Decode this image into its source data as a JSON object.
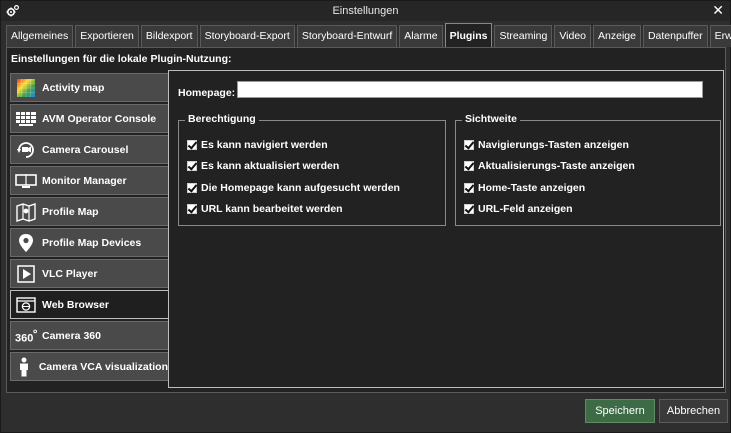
{
  "window": {
    "title": "Einstellungen",
    "close_glyph": "✕"
  },
  "tabs": [
    {
      "label": "Allgemeines",
      "active": false
    },
    {
      "label": "Exportieren",
      "active": false
    },
    {
      "label": "Bildexport",
      "active": false
    },
    {
      "label": "Storyboard-Export",
      "active": false
    },
    {
      "label": "Storyboard-Entwurf",
      "active": false
    },
    {
      "label": "Alarme",
      "active": false
    },
    {
      "label": "Plugins",
      "active": true
    },
    {
      "label": "Streaming",
      "active": false
    },
    {
      "label": "Video",
      "active": false
    },
    {
      "label": "Anzeige",
      "active": false
    },
    {
      "label": "Datenpuffer",
      "active": false
    },
    {
      "label": "Erweitert",
      "active": false
    }
  ],
  "panel": {
    "heading": "Einstellungen für die lokale Plugin-Nutzung:"
  },
  "plugins": [
    {
      "label": "Activity map",
      "icon": "heatmap-icon",
      "active": false
    },
    {
      "label": "AVM Operator Console",
      "icon": "grid-console-icon",
      "active": false
    },
    {
      "label": "Camera Carousel",
      "icon": "camera-carousel-icon",
      "active": false
    },
    {
      "label": "Monitor Manager",
      "icon": "monitor-icon",
      "active": false
    },
    {
      "label": "Profile Map",
      "icon": "map-icon",
      "active": false
    },
    {
      "label": "Profile Map Devices",
      "icon": "map-pin-icon",
      "active": false
    },
    {
      "label": "VLC Player",
      "icon": "vlc-player-icon",
      "active": false
    },
    {
      "label": "Web Browser",
      "icon": "globe-icon",
      "active": true
    },
    {
      "label": "Camera 360",
      "icon": "camera-360-icon",
      "active": false
    },
    {
      "label": "Camera VCA visualization",
      "icon": "person-icon",
      "active": false
    }
  ],
  "content": {
    "homepage_label": "Homepage:",
    "homepage_value": "",
    "permissions": {
      "title": "Berechtigung",
      "options": [
        {
          "label": "Es kann navigiert werden",
          "checked": true
        },
        {
          "label": "Es kann aktualisiert werden",
          "checked": true
        },
        {
          "label": "Die Homepage kann aufgesucht werden",
          "checked": true
        },
        {
          "label": "URL kann bearbeitet werden",
          "checked": true
        }
      ]
    },
    "visibility": {
      "title": "Sichtweite",
      "options": [
        {
          "label": "Navigierungs-Tasten anzeigen",
          "checked": true
        },
        {
          "label": "Aktualisierungs-Taste anzeigen",
          "checked": true
        },
        {
          "label": "Home-Taste anzeigen",
          "checked": true
        },
        {
          "label": "URL-Feld anzeigen",
          "checked": true
        }
      ]
    }
  },
  "footer": {
    "save_label": "Speichern",
    "cancel_label": "Abbrechen"
  },
  "colors": {
    "save_button": "#3d6b46",
    "background": "#222222"
  }
}
